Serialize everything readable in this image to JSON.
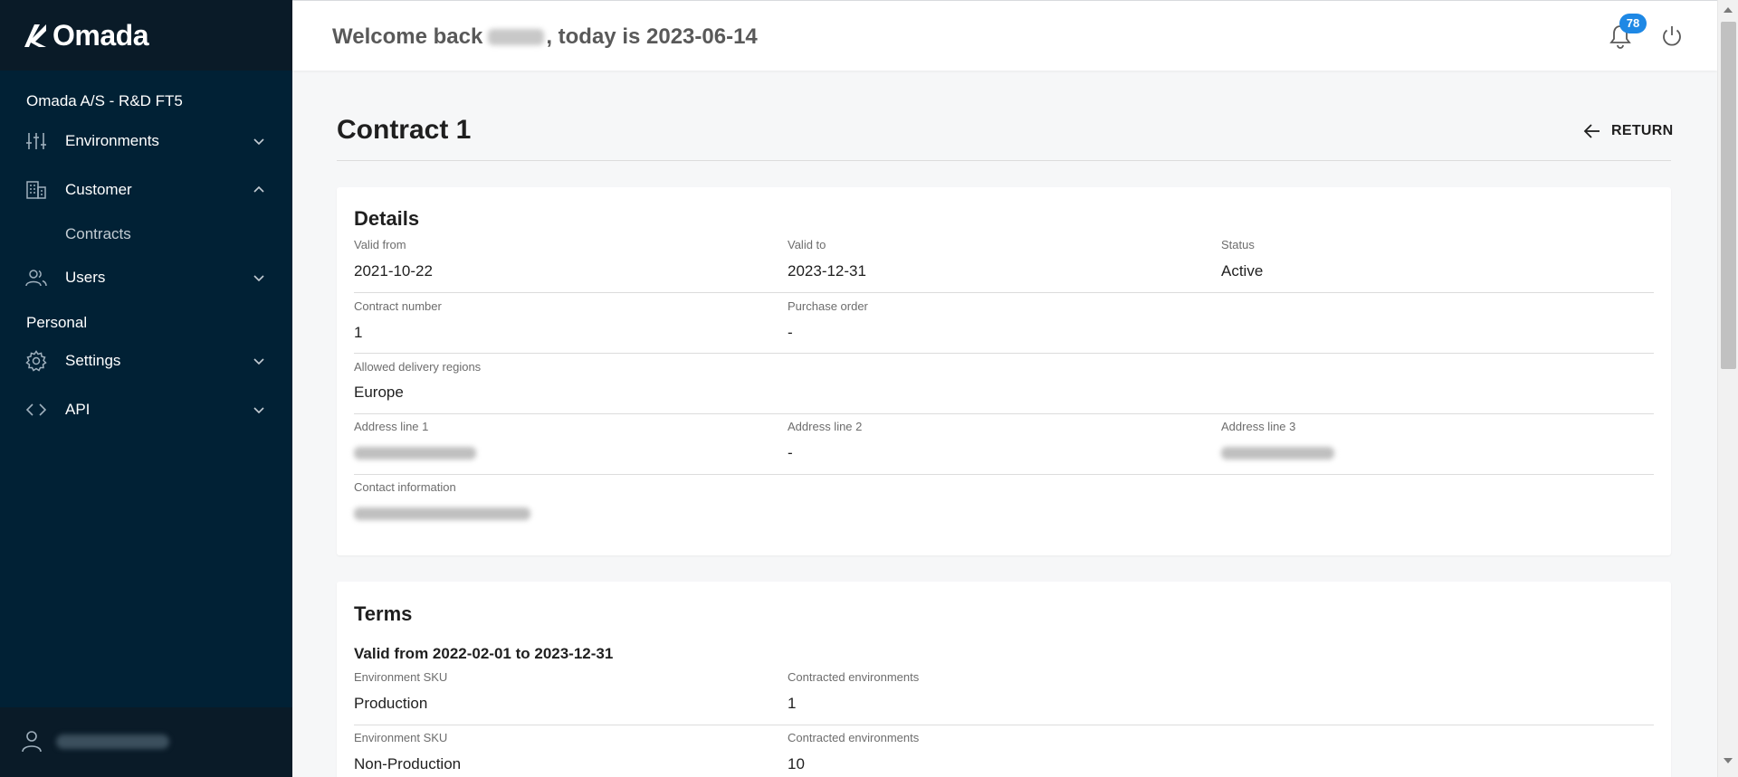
{
  "app": {
    "brand": "Omada"
  },
  "sidebar": {
    "org_name": "Omada A/S - R&D FT5",
    "items": [
      {
        "label": "Environments",
        "icon": "sliders-icon",
        "expanded": false
      },
      {
        "label": "Customer",
        "icon": "building-icon",
        "expanded": true,
        "sub": [
          "Contracts"
        ]
      },
      {
        "label": "Users",
        "icon": "users-icon",
        "expanded": false
      }
    ],
    "personal_label": "Personal",
    "personal_items": [
      {
        "label": "Settings",
        "icon": "gear-icon",
        "expanded": false
      },
      {
        "label": "API",
        "icon": "code-icon",
        "expanded": false
      }
    ]
  },
  "header": {
    "welcome_prefix": "Welcome back",
    "welcome_suffix": ", today is 2023-06-14",
    "notification_count": "78"
  },
  "page": {
    "title": "Contract 1",
    "return_label": "RETURN"
  },
  "details": {
    "title": "Details",
    "valid_from_label": "Valid from",
    "valid_from": "2021-10-22",
    "valid_to_label": "Valid to",
    "valid_to": "2023-12-31",
    "status_label": "Status",
    "status": "Active",
    "contract_number_label": "Contract number",
    "contract_number": "1",
    "purchase_order_label": "Purchase order",
    "purchase_order": "-",
    "regions_label": "Allowed delivery regions",
    "regions": "Europe",
    "address1_label": "Address line 1",
    "address2_label": "Address line 2",
    "address2": "-",
    "address3_label": "Address line 3",
    "contact_label": "Contact information"
  },
  "terms": {
    "title": "Terms",
    "period": "Valid from 2022-02-01 to 2023-12-31",
    "rows": [
      {
        "sku_label": "Environment SKU",
        "sku": "Production",
        "count_label": "Contracted environments",
        "count": "1"
      },
      {
        "sku_label": "Environment SKU",
        "sku": "Non-Production",
        "count_label": "Contracted environments",
        "count": "10"
      }
    ]
  },
  "colors": {
    "sidebar_bg": "#012135",
    "sidebar_dark": "#0a1b28",
    "badge": "#1e88e5"
  }
}
